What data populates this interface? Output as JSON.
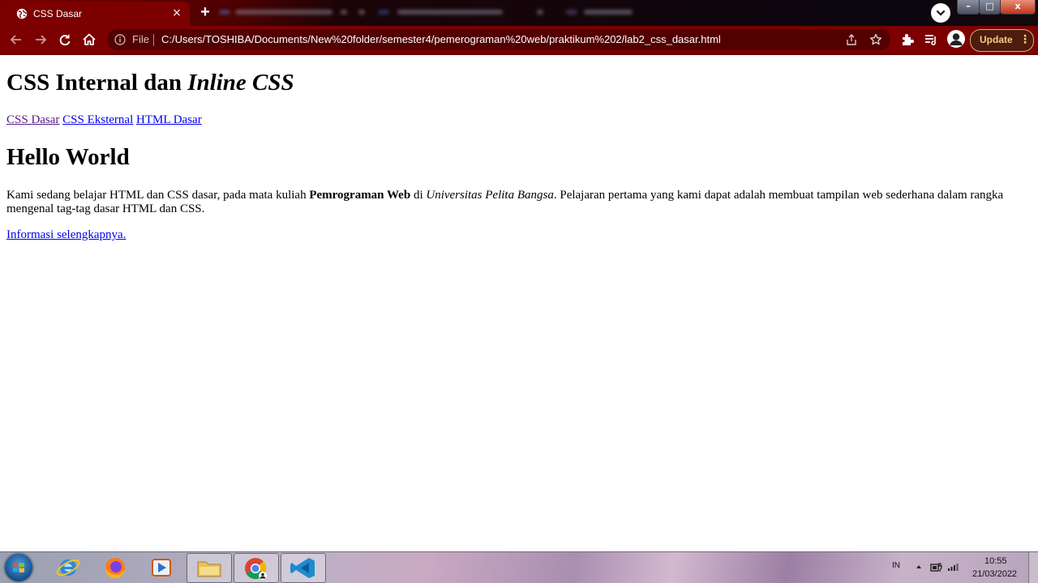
{
  "browser": {
    "active_tab": {
      "title": "CSS Dasar",
      "close_label": "×"
    },
    "new_tab_label": "+",
    "window_buttons": {
      "minimize": "–",
      "maximize": "□",
      "close": "x"
    },
    "omnibox": {
      "scheme_label": "File",
      "url": "C:/Users/TOSHIBA/Documents/New%20folder/semester4/pemerograman%20web/praktikum%202/lab2_css_dasar.html"
    },
    "update_button": {
      "label": "Update",
      "menu_glyph": "⋮"
    }
  },
  "page": {
    "heading_main_plain": "CSS Internal dan ",
    "heading_main_italic": "Inline CSS",
    "nav_links": [
      "CSS Dasar",
      "CSS Eksternal",
      "HTML Dasar"
    ],
    "heading_hello": "Hello World",
    "paragraph": {
      "part1": "Kami sedang belajar HTML dan CSS dasar, pada mata kuliah ",
      "bold": "Pemrograman Web",
      "part2": " di ",
      "italic": "Universitas Pelita Bangsa",
      "part3": ". Pelajaran pertama yang kami dapat adalah membuat tampilan web sederhana dalam rangka mengenal tag-tag dasar HTML dan CSS."
    },
    "more_link": "Informasi selengkapnya."
  },
  "taskbar": {
    "language": "IN",
    "time": "10:55",
    "date": "21/03/2022"
  },
  "colors": {
    "chrome_theme": "#7c0000",
    "link": "#0000ee",
    "visited_link": "#551a8b",
    "update_text": "#f2cf85"
  }
}
